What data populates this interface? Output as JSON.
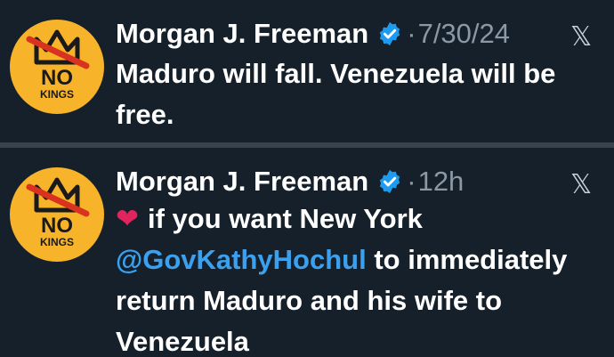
{
  "tweets": [
    {
      "author_name": "Morgan J. Freeman",
      "separator": "·",
      "timestamp": "7/30/24",
      "platform_logo": "𝕏",
      "avatar_text_main": "NO",
      "avatar_text_sub": "KINGS",
      "text": "Maduro will fall. Venezuela will be free."
    },
    {
      "author_name": "Morgan J. Freeman",
      "separator": "·",
      "timestamp": "12h",
      "platform_logo": "𝕏",
      "avatar_text_main": "NO",
      "avatar_text_sub": "KINGS",
      "heart_emoji": "❤",
      "text_before_mention": "if you want New York",
      "mention": "@GovKathyHochul",
      "text_after_mention": "to immediately return Maduro and his wife to Venezuela"
    }
  ],
  "colors": {
    "background": "#15202b",
    "divider": "#38444d",
    "avatar": "#f7b329",
    "verified": "#1d9bf0",
    "mention": "#3ba1ef",
    "muted": "#8b98a5",
    "heart": "#e0245e"
  },
  "icons": {
    "verified": "verified-badge-icon",
    "avatar": "no-kings-crown-logo",
    "platform": "x-logo-icon",
    "heart": "red-heart-emoji"
  }
}
